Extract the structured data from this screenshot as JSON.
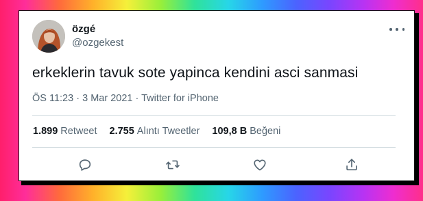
{
  "tweet": {
    "author": {
      "display_name": "özgé",
      "handle": "@ozgekest"
    },
    "text": "erkeklerin tavuk sote yapinca kendini asci sanmasi",
    "time": "ÖS 11:23",
    "date": "3 Mar 2021",
    "separator": "·",
    "source": "Twitter for iPhone",
    "stats": [
      {
        "value": "1.899",
        "label": "Retweet"
      },
      {
        "value": "2.755",
        "label": "Alıntı Tweetler"
      },
      {
        "value": "109,8 B",
        "label": "Beğeni"
      }
    ],
    "actions": [
      "reply-icon",
      "retweet-icon",
      "like-icon",
      "share-icon"
    ]
  },
  "colors": {
    "text_primary": "#0f1419",
    "text_secondary": "#536471",
    "divider": "#cfd9de"
  }
}
